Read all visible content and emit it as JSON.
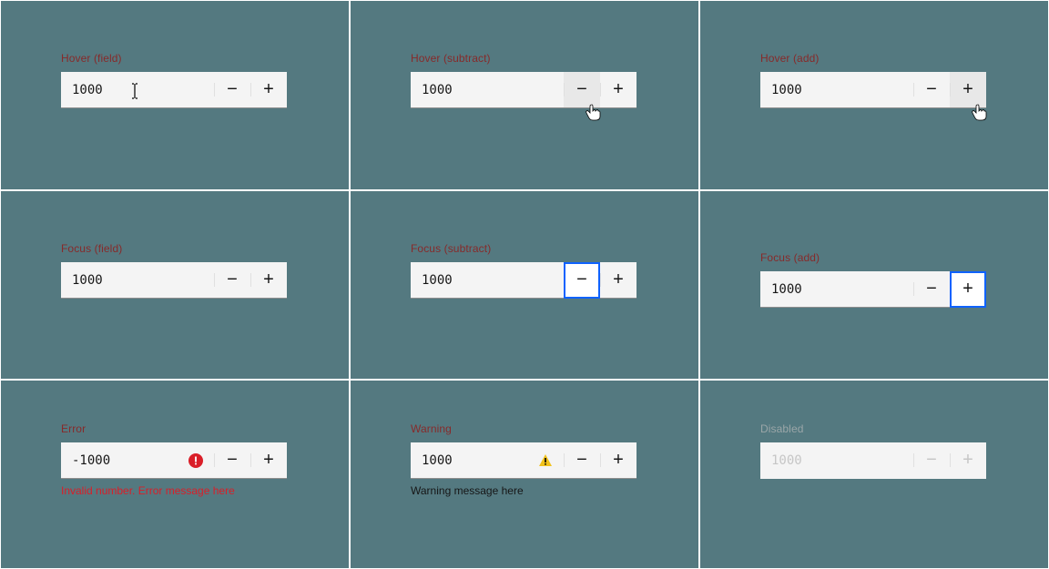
{
  "colors": {
    "focus": "#0f62fe",
    "error": "#da1e28",
    "warning": "#f1c21b",
    "bg": "#547980",
    "field": "#f4f4f4"
  },
  "glyphs": {
    "minus": "−",
    "plus": "+"
  },
  "cells": {
    "hover_field": {
      "label": "Hover (field)",
      "value": "1000"
    },
    "hover_subtract": {
      "label": "Hover (subtract)",
      "value": "1000"
    },
    "hover_add": {
      "label": "Hover (add)",
      "value": "1000"
    },
    "focus_field": {
      "label": "Focus (field)",
      "value": "1000"
    },
    "focus_subtract": {
      "label": "Focus (subtract)",
      "value": "1000"
    },
    "focus_add": {
      "label": "Focus (add)",
      "value": "1000"
    },
    "error": {
      "label": "Error",
      "value": "-1000",
      "helper": "Invalid number. Error message here"
    },
    "warning": {
      "label": "Warning",
      "value": "1000",
      "helper": "Warning message here"
    },
    "disabled": {
      "label": "Disabled",
      "value": "1000"
    }
  }
}
